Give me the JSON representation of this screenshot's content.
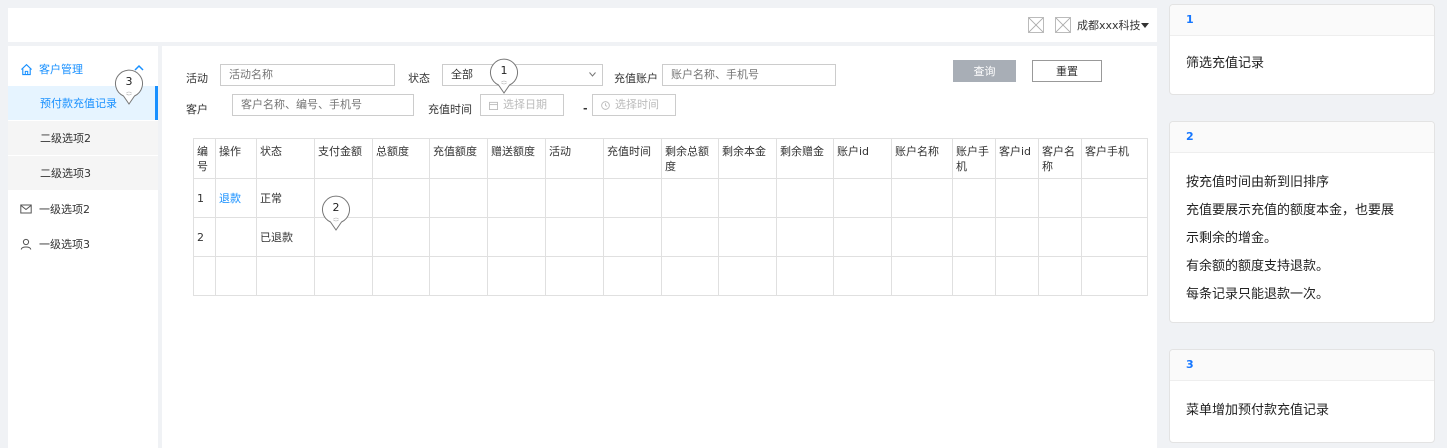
{
  "header": {
    "company": "成都xxx科技"
  },
  "sidebar": {
    "parent": {
      "label": "客户管理",
      "icon": "home-icon"
    },
    "subitems": [
      {
        "label": "预付款充值记录",
        "active": true
      },
      {
        "label": "二级选项2"
      },
      {
        "label": "二级选项3"
      }
    ],
    "items": [
      {
        "label": "一级选项2",
        "icon": "mail-icon"
      },
      {
        "label": "一级选项3",
        "icon": "user-icon"
      }
    ]
  },
  "filters": {
    "activity": {
      "label": "活动",
      "placeholder": "活动名称"
    },
    "status": {
      "label": "状态",
      "value": "全部"
    },
    "account": {
      "label": "充值账户",
      "placeholder": "账户名称、手机号"
    },
    "customer": {
      "label": "客户",
      "placeholder": "客户名称、编号、手机号"
    },
    "time": {
      "label": "充值时间",
      "start_placeholder": "选择日期",
      "dash": "-",
      "end_placeholder": "选择时间"
    },
    "query_label": "查询",
    "reset_label": "重置"
  },
  "table": {
    "columns": [
      "编号",
      "操作",
      "状态",
      "支付金额",
      "总额度",
      "充值额度",
      "赠送额度",
      "活动",
      "充值时间",
      "剩余总额度",
      "剩余本金",
      "剩余赠金",
      "账户id",
      "账户名称",
      "账户手机",
      "客户id",
      "客户名称",
      "客户手机"
    ],
    "rows": [
      {
        "id": "1",
        "action": "退款",
        "status": "正常"
      },
      {
        "id": "2",
        "action": "",
        "status": "已退款"
      },
      {
        "id": "",
        "action": "",
        "status": ""
      }
    ]
  },
  "annotations": [
    {
      "num": "1"
    },
    {
      "num": "2"
    },
    {
      "num": "3"
    }
  ],
  "notes": [
    {
      "num": "1",
      "lines": [
        "筛选充值记录"
      ]
    },
    {
      "num": "2",
      "lines": [
        "按充值时间由新到旧排序",
        "充值要展示充值的额度本金，也要展",
        "示剩余的增金。",
        "有余额的额度支持退款。",
        "每条记录只能退款一次。"
      ]
    },
    {
      "num": "3",
      "lines": [
        "菜单增加预付款充值记录"
      ]
    }
  ],
  "colors": {
    "accent": "#1890ff",
    "note_header": "#1677ff",
    "query_button": "#a8aeb6"
  }
}
